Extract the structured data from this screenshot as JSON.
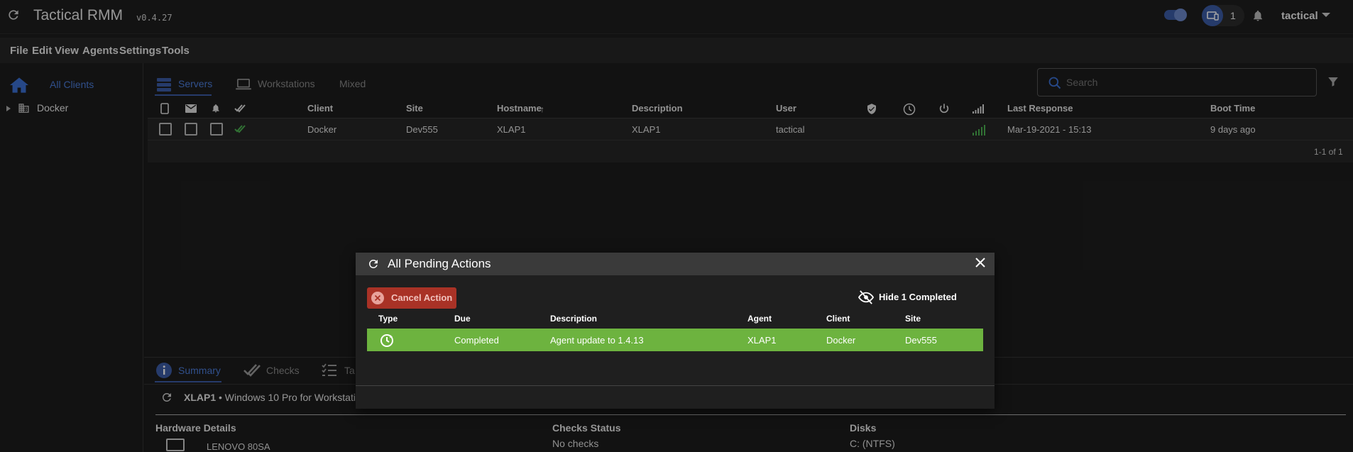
{
  "app": {
    "title": "Tactical RMM",
    "version": "v0.4.27",
    "agent_count": "1",
    "user": "tactical"
  },
  "menu": [
    "File",
    "Edit",
    "View",
    "Agents",
    "Settings",
    "Tools"
  ],
  "sidebar": {
    "all_clients": "All Clients",
    "tree": [
      {
        "label": "Docker"
      }
    ]
  },
  "tabs": {
    "servers": "Servers",
    "workstations": "Workstations",
    "mixed": "Mixed"
  },
  "search": {
    "placeholder": "Search"
  },
  "table": {
    "headers": {
      "client": "Client",
      "site": "Site",
      "hostname": "Hostname",
      "description": "Description",
      "user": "User",
      "last_response": "Last Response",
      "boot_time": "Boot Time"
    },
    "rows": [
      {
        "client": "Docker",
        "site": "Dev555",
        "hostname": "XLAP1",
        "description": "XLAP1",
        "user": "tactical",
        "last_response": "Mar-19-2021 - 15:13",
        "boot_time": "9 days ago"
      }
    ],
    "pagination": "1-1 of 1"
  },
  "bottom": {
    "tabs": {
      "summary": "Summary",
      "checks": "Checks",
      "tasks": "Ta"
    },
    "agent_name": "XLAP1",
    "agent_os": " • Windows 10 Pro for Workstatio",
    "hardware_title": "Hardware Details",
    "hardware_model": "LENOVO 80SA",
    "checks_title": "Checks Status",
    "checks_value": "No checks",
    "disks_title": "Disks",
    "disks_value": "C: (NTFS)"
  },
  "modal": {
    "title": "All Pending Actions",
    "cancel_label": "Cancel Action",
    "hide_label": "Hide 1 Completed",
    "headers": {
      "type": "Type",
      "due": "Due",
      "description": "Description",
      "agent": "Agent",
      "client": "Client",
      "site": "Site"
    },
    "rows": [
      {
        "due": "Completed",
        "description": "Agent update to 1.4.13",
        "agent": "XLAP1",
        "client": "Docker",
        "site": "Dev555"
      }
    ]
  },
  "colors": {
    "accent": "#3b5ba5",
    "completed_row": "#6db33f",
    "cancel": "#c0392b",
    "signal": "#4caf50"
  }
}
